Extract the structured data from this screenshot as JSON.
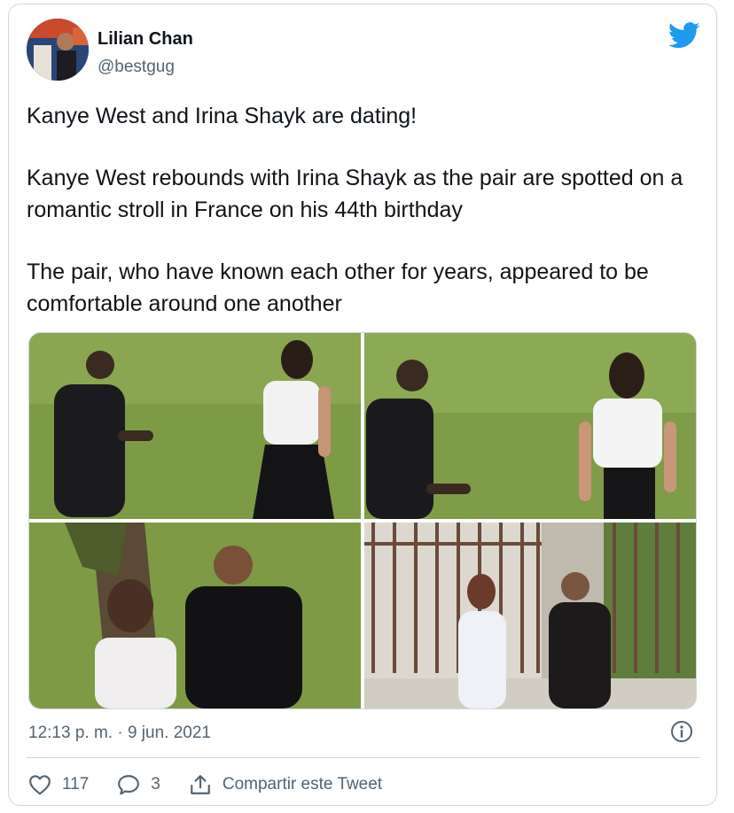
{
  "author": {
    "name": "Lilian Chan",
    "handle": "@bestgug",
    "avatar_icon": "profile-avatar"
  },
  "platform_icon": "twitter-bird-icon",
  "tweet": {
    "paragraphs": [
      "Kanye West and Irina Shayk are dating!",
      "Kanye West rebounds with Irina Shayk as the pair are spotted on a romantic stroll in France on his 44th birthday",
      "The pair, who have known each other for years, appeared to be comfortable around one another"
    ]
  },
  "media": {
    "photo_count": 4
  },
  "meta": {
    "timestamp": "12:13 p. m. · 9 jun. 2021"
  },
  "actions": {
    "like_count": "117",
    "reply_count": "3",
    "share_label": "Compartir este Tweet"
  },
  "colors": {
    "brand": "#1d9bf0",
    "secondary_text": "#536471",
    "border": "#cfd9de"
  }
}
